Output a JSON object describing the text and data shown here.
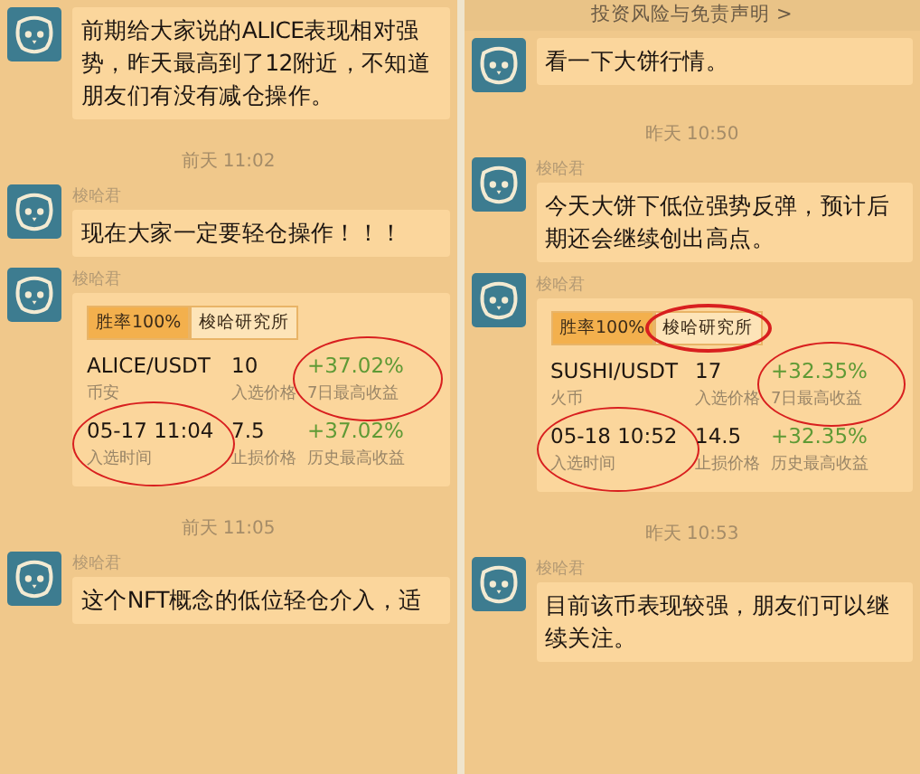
{
  "panels": [
    {
      "messages": [
        {
          "kind": "text",
          "text": "前期给大家说的ALICE表现相对强势，昨天最高到了12附近，不知道朋友们有没有减仓操作。"
        },
        {
          "kind": "time",
          "text": "前天 11:02"
        },
        {
          "kind": "text",
          "sender": "梭哈君",
          "text": "现在大家一定要轻仓操作！！！"
        },
        {
          "kind": "card",
          "sender": "梭哈君",
          "tags": [
            {
              "kind": "rate",
              "text": "胜率100%",
              "circled": false
            },
            {
              "kind": "source",
              "text": "梭哈研究所",
              "circled": false
            }
          ],
          "rows": [
            [
              {
                "value": "ALICE/USDT",
                "label": "币安",
                "gain": false,
                "circled": false
              },
              {
                "value": "10",
                "label": "入选价格",
                "gain": false,
                "circled": false
              },
              {
                "value": "+37.02%",
                "label": "7日最高收益",
                "gain": true,
                "circled": true
              }
            ],
            [
              {
                "value": "05-17 11:04",
                "label": "入选时间",
                "gain": false,
                "circled": true
              },
              {
                "value": "7.5",
                "label": "止损价格",
                "gain": false,
                "circled": false
              },
              {
                "value": "+37.02%",
                "label": "历史最高收益",
                "gain": true,
                "circled": false
              }
            ]
          ]
        },
        {
          "kind": "time",
          "text": "前天 11:05"
        },
        {
          "kind": "text",
          "sender": "梭哈君",
          "text": "这个NFT概念的低位轻仓介入，适"
        }
      ]
    },
    {
      "banner": "投资风险与免责声明 >",
      "messages": [
        {
          "kind": "text",
          "text": "看一下大饼行情。"
        },
        {
          "kind": "time",
          "text": "昨天 10:50"
        },
        {
          "kind": "text",
          "sender": "梭哈君",
          "text": "今天大饼下低位强势反弹，预计后期还会继续创出高点。"
        },
        {
          "kind": "card",
          "sender": "梭哈君",
          "tags": [
            {
              "kind": "rate",
              "text": "胜率100%",
              "circled": false
            },
            {
              "kind": "source",
              "text": "梭哈研究所",
              "circled": true
            }
          ],
          "rows": [
            [
              {
                "value": "SUSHI/USDT",
                "label": "火币",
                "gain": false,
                "circled": false
              },
              {
                "value": "17",
                "label": "入选价格",
                "gain": false,
                "circled": false
              },
              {
                "value": "+32.35%",
                "label": "7日最高收益",
                "gain": true,
                "circled": true
              }
            ],
            [
              {
                "value": "05-18 10:52",
                "label": "入选时间",
                "gain": false,
                "circled": true
              },
              {
                "value": "14.5",
                "label": "止损价格",
                "gain": false,
                "circled": false
              },
              {
                "value": "+32.35%",
                "label": "历史最高收益",
                "gain": true,
                "circled": false
              }
            ]
          ]
        },
        {
          "kind": "time",
          "text": "昨天 10:53"
        },
        {
          "kind": "text",
          "sender": "梭哈君",
          "text": "目前该币表现较强，朋友们可以继续关注。"
        }
      ]
    }
  ]
}
